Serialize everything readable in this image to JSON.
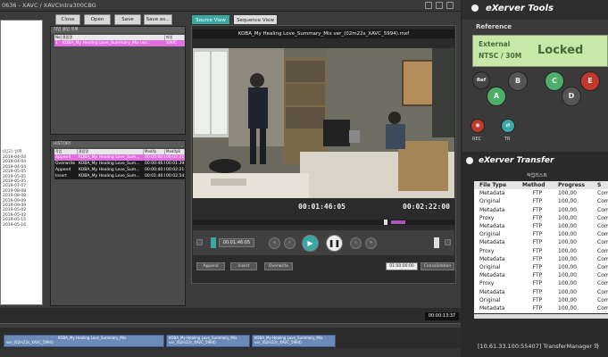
{
  "editor": {
    "title": "0636 - XAVC / XAVCIntra300CBG",
    "buttons": {
      "close": "Close",
      "open": "Open",
      "save": "Save",
      "save_as": "Save as..."
    },
    "left_list": {
      "header": "(입고) 날짜",
      "rows": [
        "2019-04-04",
        "2019-04-04",
        "2019-04-04",
        "2019-05-05",
        "2019-05-05",
        "2019-05-05",
        "2019-07-07",
        "2019-08-08",
        "2019-08-08",
        "2019-09-09",
        "2019-09-09",
        "2019-05-02",
        "2019-05-02",
        "2019-05-15",
        "2019-05-16"
      ]
    },
    "bin_panel": {
      "title": "작업 클립 목록",
      "columns": [
        "No.",
        "클립명",
        "파일"
      ],
      "rows": [
        {
          "no": "1",
          "name": "KOBA_My Healing Love_Summary_Mix ver...",
          "file": "XAVC"
        }
      ]
    },
    "history_panel": {
      "title": "HISTORY",
      "columns": [
        "작업",
        "클립명",
        "Modify",
        "ModifyB"
      ],
      "rows": [
        {
          "op": "Append",
          "name": "KOBA_My Healing Love_Sum...",
          "m1": "00:00:00:00",
          "m2": "00:02:21:59"
        },
        {
          "op": "Overwrite",
          "name": "KOBA_My Healing Love_Sum...",
          "m1": "00:00:46:05",
          "m2": "00:01:39:44"
        },
        {
          "op": "Append",
          "name": "KOBA_My Healing Love_Sum...",
          "m1": "00:00:40:08",
          "m2": "00:02:21:59"
        },
        {
          "op": "Insert",
          "name": "KOBA_My Healing Love_Sum...",
          "m1": "00:01:46:05",
          "m2": "00:02:54:04"
        }
      ]
    },
    "viewer": {
      "tabs": [
        "Source View",
        "Sequence View"
      ],
      "clip_title": "KOBA_My Healing Love_Summary_Mix ver_(02m22s_XAVC_5994).mxf",
      "timecode_current": "00:01:46:05",
      "timecode_duration": "00:02:22:00",
      "small_timecode": "00:01:46:05",
      "playhead_fraction": 0.74,
      "edit_buttons": [
        "Append",
        "Insert",
        "Overwrite"
      ],
      "dropdown": "01:00:00:00",
      "consolidation": "Consolidation"
    },
    "timeline": {
      "timecode": "00:00:13:37",
      "clips": [
        "KOBA_My Healing Love_Summary_Mix ver_(02m22s_XAVC_5994)",
        "KOBA_My Healing Love_Summary_Mix ver_(02m22s_XAVC_5994)",
        "KOBA_My Healing Love_Summary_Mix ver_(02m22s_XAVC_5994)"
      ]
    }
  },
  "tools": {
    "title": "eXerver Tools",
    "reference_label": "Reference",
    "ref_status_line1": "External",
    "ref_status_line2": "NTSC / 30M",
    "locked": "Locked",
    "ref_button": "Ref",
    "channel_buttons": [
      "A",
      "B",
      "C",
      "D",
      "E"
    ],
    "rec": "REC",
    "tr": "TR",
    "accent_green": "#4cae6a",
    "accent_red": "#c0392b",
    "accent_teal": "#3aa7a3"
  },
  "transfer": {
    "title": "eXerver Transfer",
    "subtitle": "작업리스트",
    "columns": [
      "File Type",
      "Method",
      "Progress",
      "S"
    ],
    "rows": [
      [
        "Metadata",
        "FTP",
        "100,00",
        "Com"
      ],
      [
        "Original",
        "FTP",
        "100,00",
        "Com"
      ],
      [
        "Metadata",
        "FTP",
        "100,00",
        "Com"
      ],
      [
        "Proxy",
        "FTP",
        "100,00",
        "Com"
      ],
      [
        "Metadata",
        "FTP",
        "100,00",
        "Com"
      ],
      [
        "Original",
        "FTP",
        "100,00",
        "Com"
      ],
      [
        "Metadata",
        "FTP",
        "100,00",
        "Com"
      ],
      [
        "Proxy",
        "FTP",
        "100,00",
        "Com"
      ],
      [
        "Metadata",
        "FTP",
        "100,00",
        "Com"
      ],
      [
        "Original",
        "FTP",
        "100,00",
        "Com"
      ],
      [
        "Metadata",
        "FTP",
        "100,00",
        "Com"
      ],
      [
        "Proxy",
        "FTP",
        "100,00",
        "Com"
      ],
      [
        "Metadata",
        "FTP",
        "100,00",
        "Com"
      ],
      [
        "Original",
        "FTP",
        "100,00",
        "Com"
      ],
      [
        "Metadata",
        "FTP",
        "100,00",
        "Com"
      ],
      [
        "Proxy",
        "FTP",
        "100,00",
        "Com"
      ]
    ],
    "status": "[10.61.33.100:55407]  TransferManager  와"
  }
}
